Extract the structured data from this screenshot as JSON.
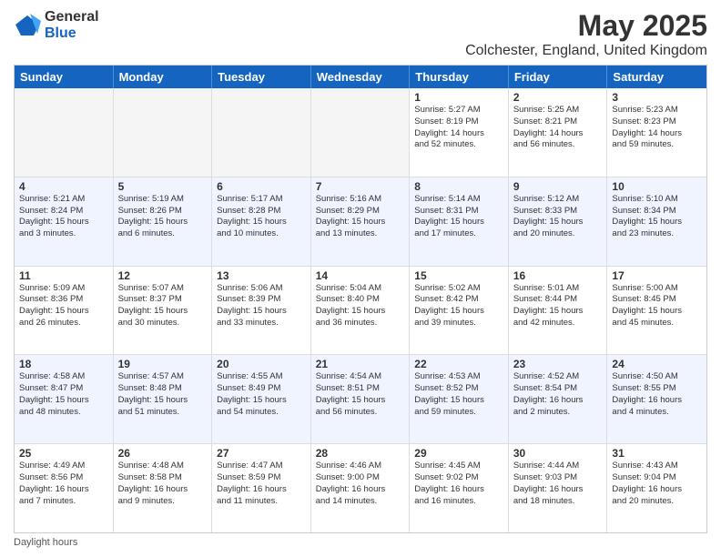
{
  "logo": {
    "general": "General",
    "blue": "Blue"
  },
  "title": "May 2025",
  "subtitle": "Colchester, England, United Kingdom",
  "days_of_week": [
    "Sunday",
    "Monday",
    "Tuesday",
    "Wednesday",
    "Thursday",
    "Friday",
    "Saturday"
  ],
  "footer": "Daylight hours",
  "weeks": [
    [
      {
        "day": "",
        "info": ""
      },
      {
        "day": "",
        "info": ""
      },
      {
        "day": "",
        "info": ""
      },
      {
        "day": "",
        "info": ""
      },
      {
        "day": "1",
        "info": "Sunrise: 5:27 AM\nSunset: 8:19 PM\nDaylight: 14 hours\nand 52 minutes."
      },
      {
        "day": "2",
        "info": "Sunrise: 5:25 AM\nSunset: 8:21 PM\nDaylight: 14 hours\nand 56 minutes."
      },
      {
        "day": "3",
        "info": "Sunrise: 5:23 AM\nSunset: 8:23 PM\nDaylight: 14 hours\nand 59 minutes."
      }
    ],
    [
      {
        "day": "4",
        "info": "Sunrise: 5:21 AM\nSunset: 8:24 PM\nDaylight: 15 hours\nand 3 minutes."
      },
      {
        "day": "5",
        "info": "Sunrise: 5:19 AM\nSunset: 8:26 PM\nDaylight: 15 hours\nand 6 minutes."
      },
      {
        "day": "6",
        "info": "Sunrise: 5:17 AM\nSunset: 8:28 PM\nDaylight: 15 hours\nand 10 minutes."
      },
      {
        "day": "7",
        "info": "Sunrise: 5:16 AM\nSunset: 8:29 PM\nDaylight: 15 hours\nand 13 minutes."
      },
      {
        "day": "8",
        "info": "Sunrise: 5:14 AM\nSunset: 8:31 PM\nDaylight: 15 hours\nand 17 minutes."
      },
      {
        "day": "9",
        "info": "Sunrise: 5:12 AM\nSunset: 8:33 PM\nDaylight: 15 hours\nand 20 minutes."
      },
      {
        "day": "10",
        "info": "Sunrise: 5:10 AM\nSunset: 8:34 PM\nDaylight: 15 hours\nand 23 minutes."
      }
    ],
    [
      {
        "day": "11",
        "info": "Sunrise: 5:09 AM\nSunset: 8:36 PM\nDaylight: 15 hours\nand 26 minutes."
      },
      {
        "day": "12",
        "info": "Sunrise: 5:07 AM\nSunset: 8:37 PM\nDaylight: 15 hours\nand 30 minutes."
      },
      {
        "day": "13",
        "info": "Sunrise: 5:06 AM\nSunset: 8:39 PM\nDaylight: 15 hours\nand 33 minutes."
      },
      {
        "day": "14",
        "info": "Sunrise: 5:04 AM\nSunset: 8:40 PM\nDaylight: 15 hours\nand 36 minutes."
      },
      {
        "day": "15",
        "info": "Sunrise: 5:02 AM\nSunset: 8:42 PM\nDaylight: 15 hours\nand 39 minutes."
      },
      {
        "day": "16",
        "info": "Sunrise: 5:01 AM\nSunset: 8:44 PM\nDaylight: 15 hours\nand 42 minutes."
      },
      {
        "day": "17",
        "info": "Sunrise: 5:00 AM\nSunset: 8:45 PM\nDaylight: 15 hours\nand 45 minutes."
      }
    ],
    [
      {
        "day": "18",
        "info": "Sunrise: 4:58 AM\nSunset: 8:47 PM\nDaylight: 15 hours\nand 48 minutes."
      },
      {
        "day": "19",
        "info": "Sunrise: 4:57 AM\nSunset: 8:48 PM\nDaylight: 15 hours\nand 51 minutes."
      },
      {
        "day": "20",
        "info": "Sunrise: 4:55 AM\nSunset: 8:49 PM\nDaylight: 15 hours\nand 54 minutes."
      },
      {
        "day": "21",
        "info": "Sunrise: 4:54 AM\nSunset: 8:51 PM\nDaylight: 15 hours\nand 56 minutes."
      },
      {
        "day": "22",
        "info": "Sunrise: 4:53 AM\nSunset: 8:52 PM\nDaylight: 15 hours\nand 59 minutes."
      },
      {
        "day": "23",
        "info": "Sunrise: 4:52 AM\nSunset: 8:54 PM\nDaylight: 16 hours\nand 2 minutes."
      },
      {
        "day": "24",
        "info": "Sunrise: 4:50 AM\nSunset: 8:55 PM\nDaylight: 16 hours\nand 4 minutes."
      }
    ],
    [
      {
        "day": "25",
        "info": "Sunrise: 4:49 AM\nSunset: 8:56 PM\nDaylight: 16 hours\nand 7 minutes."
      },
      {
        "day": "26",
        "info": "Sunrise: 4:48 AM\nSunset: 8:58 PM\nDaylight: 16 hours\nand 9 minutes."
      },
      {
        "day": "27",
        "info": "Sunrise: 4:47 AM\nSunset: 8:59 PM\nDaylight: 16 hours\nand 11 minutes."
      },
      {
        "day": "28",
        "info": "Sunrise: 4:46 AM\nSunset: 9:00 PM\nDaylight: 16 hours\nand 14 minutes."
      },
      {
        "day": "29",
        "info": "Sunrise: 4:45 AM\nSunset: 9:02 PM\nDaylight: 16 hours\nand 16 minutes."
      },
      {
        "day": "30",
        "info": "Sunrise: 4:44 AM\nSunset: 9:03 PM\nDaylight: 16 hours\nand 18 minutes."
      },
      {
        "day": "31",
        "info": "Sunrise: 4:43 AM\nSunset: 9:04 PM\nDaylight: 16 hours\nand 20 minutes."
      }
    ]
  ]
}
